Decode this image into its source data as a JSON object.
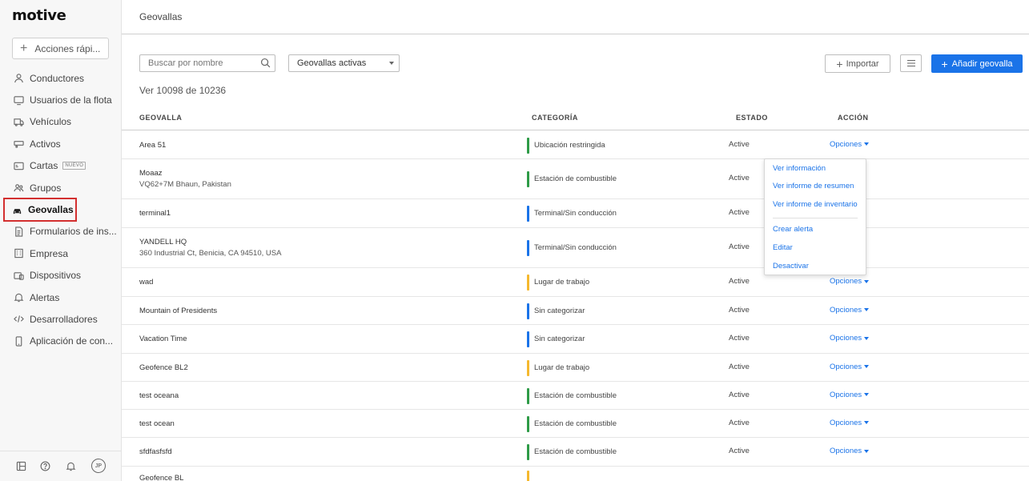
{
  "app": {
    "logo": "motive"
  },
  "sidebar": {
    "quick_actions": "Acciones rápi...",
    "items": [
      {
        "label": "Conductores",
        "icon": "person-icon"
      },
      {
        "label": "Usuarios de la flota",
        "icon": "monitor-icon"
      },
      {
        "label": "Vehículos",
        "icon": "truck-icon"
      },
      {
        "label": "Activos",
        "icon": "trailer-icon"
      },
      {
        "label": "Cartas",
        "icon": "card-icon",
        "badge": "NUEVO"
      },
      {
        "label": "Grupos",
        "icon": "group-icon"
      },
      {
        "label": "Geovallas",
        "icon": "geofence-icon",
        "active": true
      },
      {
        "label": "Formularios de ins...",
        "icon": "form-icon"
      },
      {
        "label": "Empresa",
        "icon": "building-icon"
      },
      {
        "label": "Dispositivos",
        "icon": "devices-icon"
      },
      {
        "label": "Alertas",
        "icon": "bell-icon"
      },
      {
        "label": "Desarrolladores",
        "icon": "code-icon"
      },
      {
        "label": "Aplicación de con...",
        "icon": "phone-icon"
      }
    ],
    "footer": {
      "avatar": "JP"
    }
  },
  "header": {
    "title": "Geovallas"
  },
  "toolbar": {
    "search_placeholder": "Buscar por nombre",
    "filter_value": "Geovallas activas",
    "import_label": "Importar",
    "add_label": "Añadir geovalla"
  },
  "count_text": "Ver 10098 de 10236",
  "table": {
    "headers": {
      "name": "GEOVALLA",
      "category": "CATEGORÍA",
      "status": "ESTADO",
      "action": "ACCIÓN"
    },
    "options_label": "Opciones",
    "rows": [
      {
        "name": "Area 51",
        "sub": "",
        "category": "Ubicación restringida",
        "cat_color": "#2e9b47",
        "status": "Active"
      },
      {
        "name": "Moaaz",
        "sub": "VQ62+7M Bhaun, Pakistan",
        "category": "Estación de combustible",
        "cat_color": "#2e9b47",
        "status": "Active"
      },
      {
        "name": "terminal1",
        "sub": "",
        "category": "Terminal/Sin conducción",
        "cat_color": "#1a73e8",
        "status": "Active"
      },
      {
        "name": "YANDELL HQ",
        "sub": "360 Industrial Ct, Benicia, CA 94510, USA",
        "category": "Terminal/Sin conducción",
        "cat_color": "#1a73e8",
        "status": "Active"
      },
      {
        "name": "wad",
        "sub": "",
        "category": "Lugar de trabajo",
        "cat_color": "#f5b82e",
        "status": "Active"
      },
      {
        "name": "Mountain of Presidents",
        "sub": "",
        "category": "Sin categorizar",
        "cat_color": "#1a73e8",
        "status": "Active"
      },
      {
        "name": "Vacation Time",
        "sub": "",
        "category": "Sin categorizar",
        "cat_color": "#1a73e8",
        "status": "Active"
      },
      {
        "name": "Geofence BL2",
        "sub": "",
        "category": "Lugar de trabajo",
        "cat_color": "#f5b82e",
        "status": "Active"
      },
      {
        "name": "test oceana",
        "sub": "",
        "category": "Estación de combustible",
        "cat_color": "#2e9b47",
        "status": "Active"
      },
      {
        "name": "test ocean",
        "sub": "",
        "category": "Estación de combustible",
        "cat_color": "#2e9b47",
        "status": "Active"
      },
      {
        "name": "sfdfasfsfd",
        "sub": "",
        "category": "Estación de combustible",
        "cat_color": "#2e9b47",
        "status": "Active"
      },
      {
        "name": "Geofence BL",
        "sub": "",
        "category": "",
        "cat_color": "#f5b82e",
        "status": ""
      }
    ]
  },
  "dropdown": {
    "items": [
      "Ver información",
      "Ver informe de resumen",
      "Ver informe de inventario",
      "Crear alerta",
      "Editar",
      "Desactivar"
    ]
  }
}
